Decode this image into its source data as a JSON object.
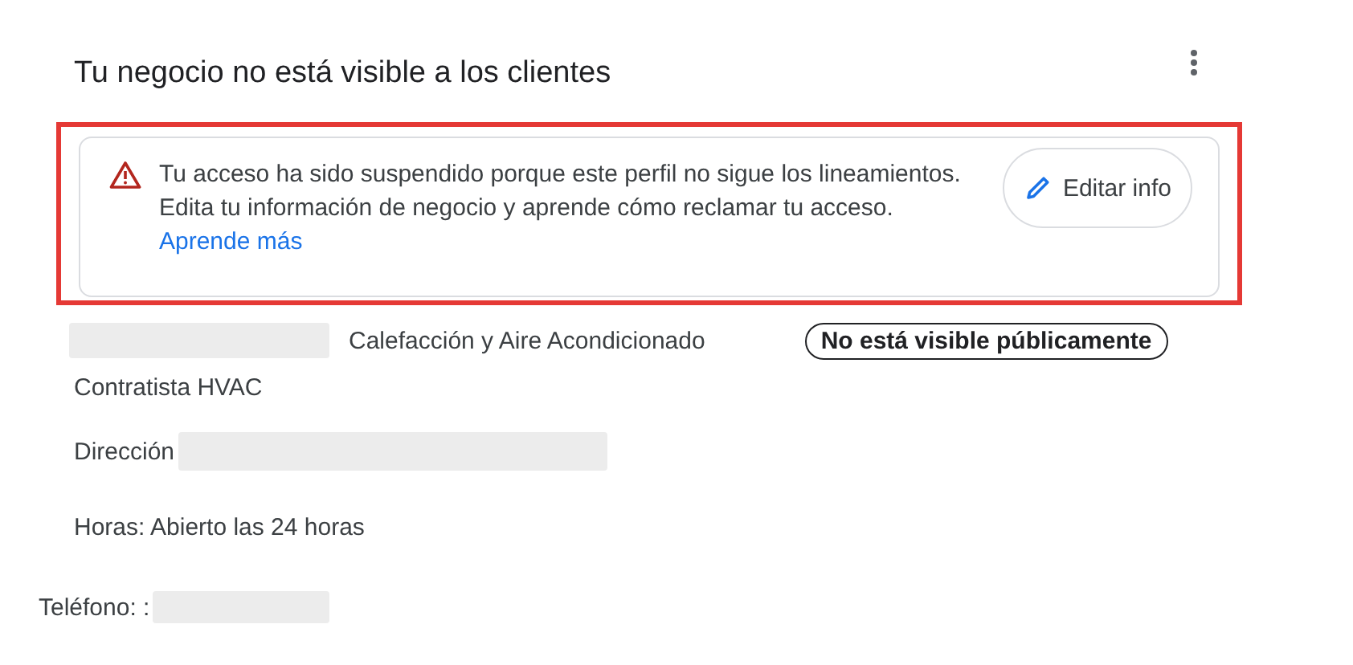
{
  "title": "Tu negocio no está visible a los clientes",
  "alert": {
    "lines": [
      "Tu acceso ha sido suspendido porque este perfil no sigue los lineamientos.",
      "Edita tu información de negocio y aprende cómo reclamar tu acceso."
    ],
    "link": "Aprende más",
    "button": "Editar info"
  },
  "category": "Calefacción y Aire Acondicionado",
  "status_badge": "No está visible públicamente",
  "business_type": "Contratista HVAC",
  "address_label": "Dirección",
  "hours": "Horas: Abierto las 24 horas",
  "phone_label": "Teléfono: :"
}
